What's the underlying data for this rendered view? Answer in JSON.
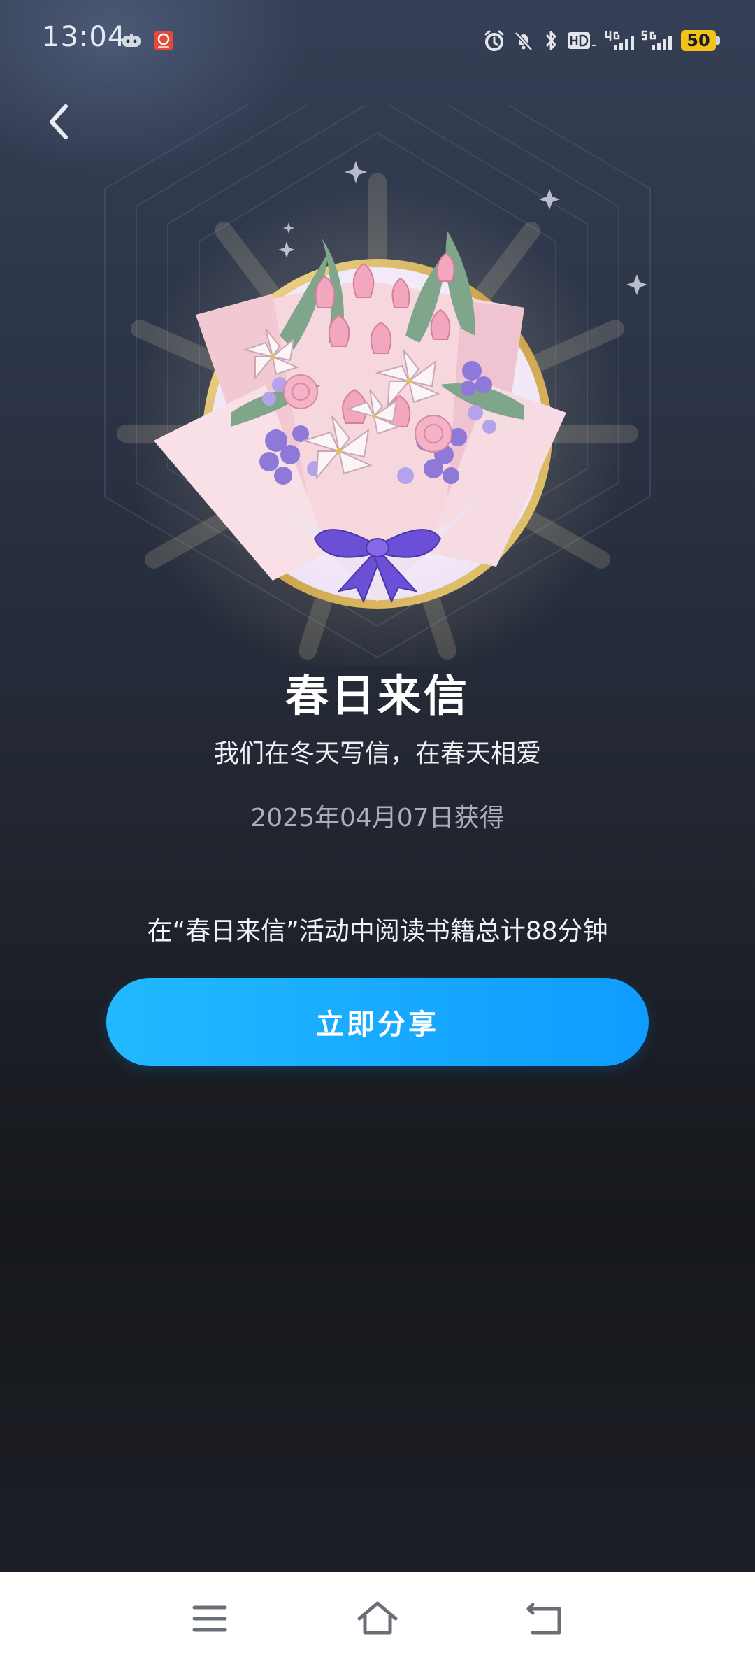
{
  "status_bar": {
    "time": "13:04",
    "battery": "50"
  },
  "badge": {
    "title": "春日来信",
    "subtitle": "我们在冬天写信，在春天相爱",
    "date": "2025年04月07日获得",
    "description": "在“春日来信”活动中阅读书籍总计88分钟"
  },
  "actions": {
    "share_label": "立即分享"
  },
  "icons": {
    "back": "chevron-left-icon",
    "menu": "menu-icon",
    "home": "home-icon",
    "return": "return-icon"
  },
  "colors": {
    "accent": "#0f9cff",
    "battery": "#f3c21a",
    "gold_ring": "#d8b14a"
  }
}
